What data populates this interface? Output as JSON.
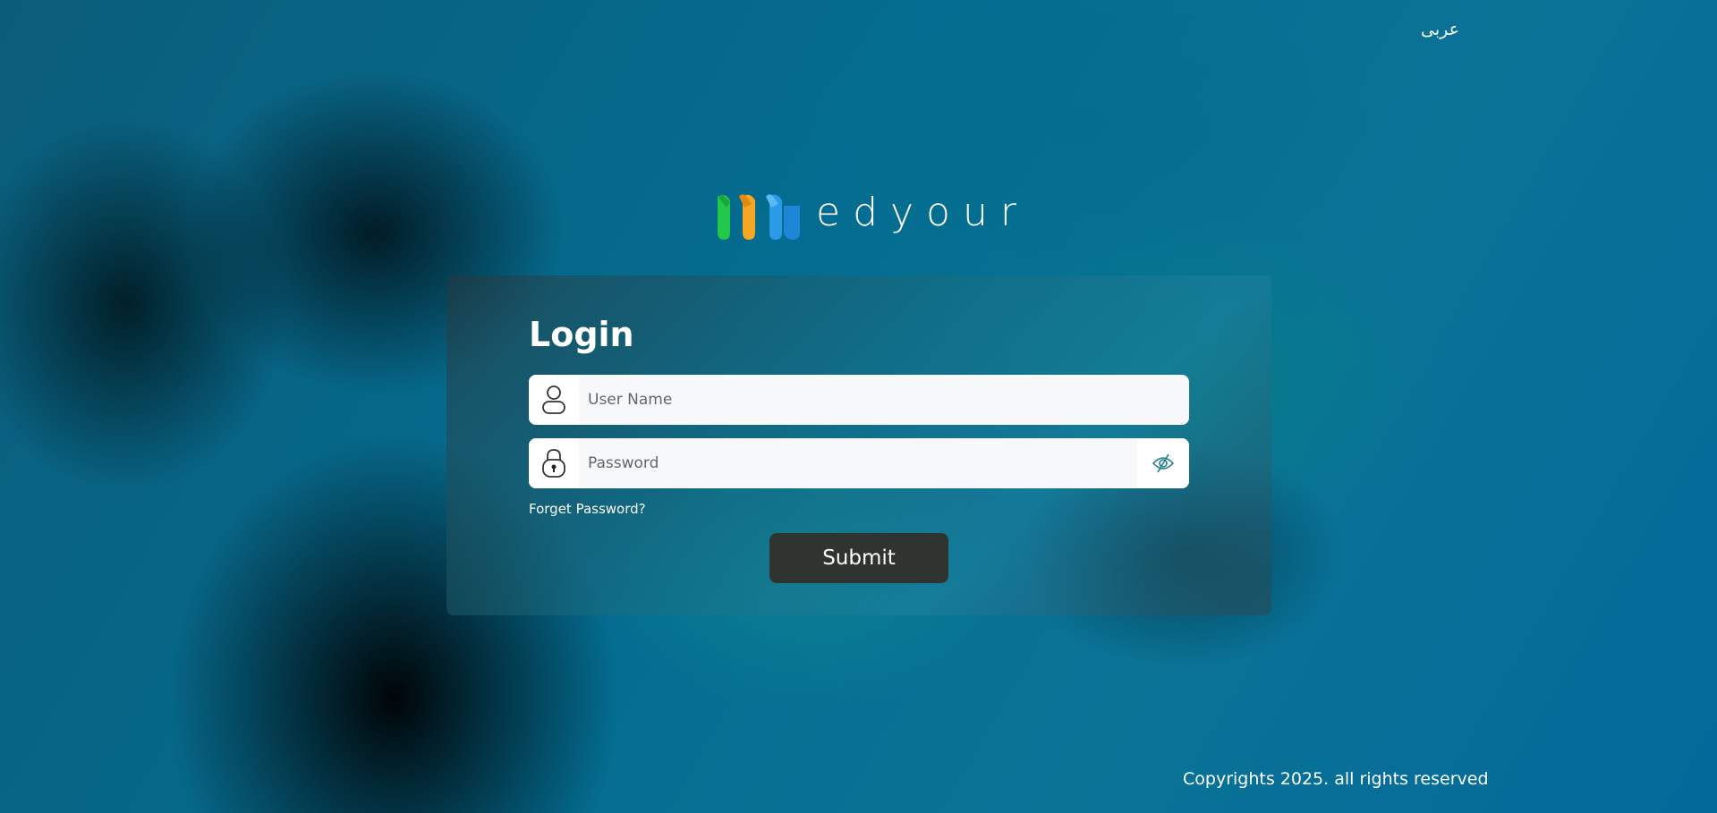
{
  "header": {
    "language_link": "عربى"
  },
  "logo": {
    "wordmark": "edyour",
    "colors": [
      "#1fbf3a",
      "#f5a623",
      "#2b9be8"
    ]
  },
  "login": {
    "title": "Login",
    "username": {
      "placeholder": "User Name",
      "value": "",
      "icon": "user-icon"
    },
    "password": {
      "placeholder": "Password",
      "value": "",
      "icon": "lock-icon",
      "toggle_icon": "eye-off-icon"
    },
    "forgot_password": "Forget Password?",
    "submit": "Submit"
  },
  "footer": {
    "copyright": "Copyrights 2025. all rights reserved"
  },
  "colors": {
    "submit_bg": "#2f3430",
    "field_bg": "#f7f8fa",
    "accent_teal": "#1f7f8c"
  }
}
